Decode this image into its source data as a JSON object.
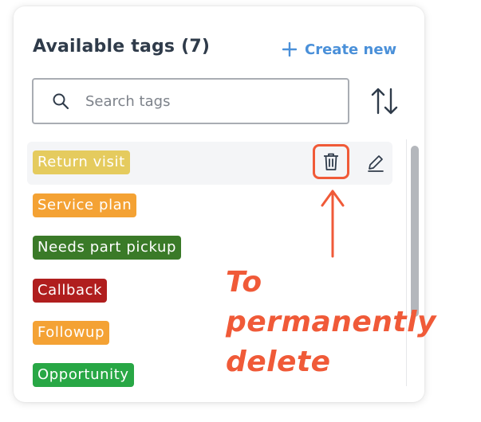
{
  "header": {
    "title": "Available tags (7)",
    "create_label": "Create new"
  },
  "search": {
    "placeholder": "Search tags",
    "value": ""
  },
  "tags": [
    {
      "label": "Return visit",
      "color": "#e5cb5e"
    },
    {
      "label": "Service plan",
      "color": "#f4a234"
    },
    {
      "label": "Needs part pickup",
      "color": "#3a7a28"
    },
    {
      "label": "Callback",
      "color": "#b01e1e"
    },
    {
      "label": "Followup",
      "color": "#f4a234"
    },
    {
      "label": "Opportunity",
      "color": "#28a745"
    }
  ],
  "icons": {
    "search": "search-icon",
    "sort": "sort-icon",
    "plus": "plus-icon",
    "trash": "trash-icon",
    "edit": "pencil-icon"
  },
  "annotation": {
    "line1": "To permanently",
    "line2": "delete",
    "color": "#f05a38"
  },
  "colors": {
    "accent": "#4a90d9",
    "title": "#2f3b4a"
  }
}
